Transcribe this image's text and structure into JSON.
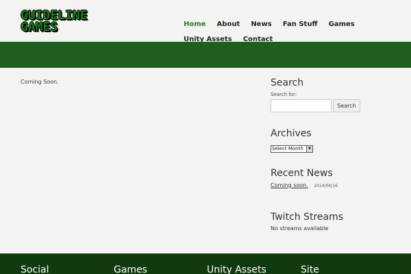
{
  "logo": {
    "line1": "GUIDELINE",
    "line2": "GAMES"
  },
  "nav": {
    "items": [
      "Home",
      "About",
      "News",
      "Fan Stuff",
      "Games",
      "Unity Assets",
      "Contact"
    ]
  },
  "content": {
    "text": "Coming Soon."
  },
  "sidebar": {
    "search": {
      "title": "Search",
      "label": "Search for:",
      "value": "",
      "button": "Search"
    },
    "archives": {
      "title": "Archives",
      "select": "Select Month"
    },
    "news": {
      "title": "Recent News",
      "item": "Coming soon.",
      "date": "2014/04/16"
    },
    "twitch": {
      "title": "Twitch Streams",
      "status": "No streams available"
    }
  },
  "footer": {
    "columns": [
      "Social",
      "Games",
      "Unity Assets",
      "Site"
    ]
  },
  "colors": {
    "accent": "#2a7a1f",
    "band": "#1f5e1c",
    "footer": "#113a10"
  }
}
